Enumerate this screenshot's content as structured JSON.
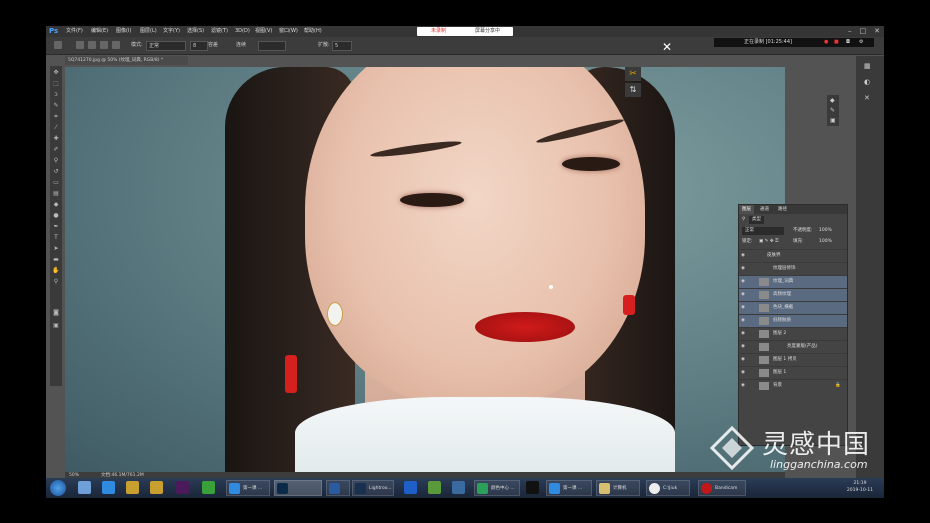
{
  "app": {
    "logo": "Ps",
    "name": "Photoshop"
  },
  "menu": [
    "文件(F)",
    "编辑(E)",
    "图像(I)",
    "图层(L)",
    "文字(Y)",
    "选择(S)",
    "滤镜(T)",
    "3D(D)",
    "视图(V)",
    "窗口(W)",
    "帮助(H)"
  ],
  "recording": {
    "left": "未录制",
    "right": "屏幕分享中",
    "status": "正在录制 [01:25:44]"
  },
  "options_bar": {
    "mode_label": "模式:",
    "mode_value": "正常",
    "opacity_value": "8",
    "tolerance_label": "容差",
    "antialias_label": "连续",
    "spread_label": "扩散:",
    "spread_value": "5"
  },
  "document": {
    "tab": "5Q741270.jpg @ 50% (纹理_词典, RGB/8) *",
    "zoom": "50%",
    "doc_size": "文档:46.1M/761.2M"
  },
  "layers_panel": {
    "tabs": [
      "图层",
      "通道",
      "路径"
    ],
    "filter_label": "类型",
    "blend_mode": "正常",
    "opacity_label": "不透明度:",
    "opacity_value": "100%",
    "lock_label": "锁定:",
    "fill_label": "填充:",
    "fill_value": "100%",
    "layers": [
      {
        "name": "皮肤界",
        "selected": false
      },
      {
        "name": "纹理层修饰",
        "selected": false
      },
      {
        "name": "纹理_词典",
        "selected": true
      },
      {
        "name": "高频纹理",
        "selected": true
      },
      {
        "name": "色块_横截",
        "selected": true
      },
      {
        "name": "低频肤质",
        "selected": true
      },
      {
        "name": "图层 2",
        "selected": false
      },
      {
        "name": "亮度蒙版(产品)",
        "selected": false
      },
      {
        "name": "图层 1 拷贝",
        "selected": false
      },
      {
        "name": "图层 1",
        "selected": false
      },
      {
        "name": "背景",
        "selected": false
      }
    ]
  },
  "taskbar": {
    "buttons": [
      "第一课 ...",
      "Lightroo...",
      "颜色中心 ...",
      "第一课 ...",
      "计算机",
      "C:\\Jiuk",
      "Bandicam"
    ],
    "clock_time": "21:19",
    "clock_date": "2019-10-11"
  },
  "watermark": {
    "title": "灵感中国",
    "url": "lingganchina.com"
  },
  "colors": {
    "accent": "#4aa3ff",
    "lips": "#d11a1a",
    "selection": "#5a6a80"
  }
}
